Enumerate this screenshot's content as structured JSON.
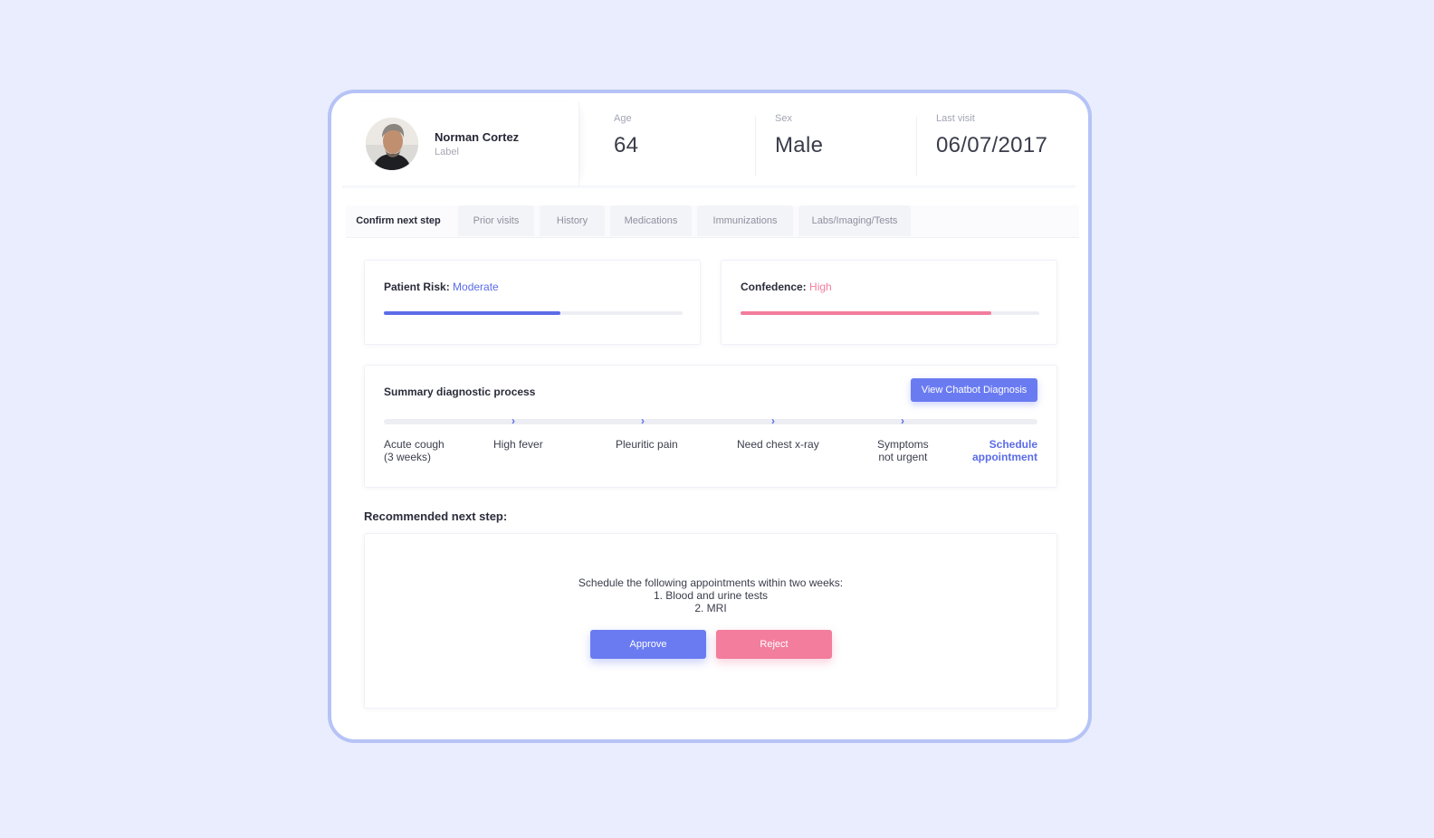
{
  "patient": {
    "name": "Norman Cortez",
    "label": "Label"
  },
  "stats": {
    "age_label": "Age",
    "age_value": "64",
    "sex_label": "Sex",
    "sex_value": "Male",
    "last_visit_label": "Last visit",
    "last_visit_value": "06/07/2017"
  },
  "tabs": [
    {
      "label": "Confirm next step",
      "active": true
    },
    {
      "label": "Prior visits"
    },
    {
      "label": "History"
    },
    {
      "label": "Medications"
    },
    {
      "label": "Immunizations"
    },
    {
      "label": "Labs/Imaging/Tests"
    }
  ],
  "risk": {
    "label": "Patient Risk:",
    "value": "Moderate",
    "level": 0.59,
    "color": "#5b6ce8"
  },
  "confidence": {
    "label": "Confedence:",
    "value": "High",
    "level": 0.84,
    "color": "#f27d9d"
  },
  "summary": {
    "title": "Summary diagnostic process",
    "button_label": "View Chatbot Diagnosis",
    "steps": [
      {
        "line1": "Acute cough",
        "line2": "(3 weeks)"
      },
      {
        "line1": "High fever",
        "line2": ""
      },
      {
        "line1": "Pleuritic pain",
        "line2": ""
      },
      {
        "line1": "Need chest x-ray",
        "line2": ""
      },
      {
        "line1": "Symptoms",
        "line2": "not urgent"
      },
      {
        "line1": "Schedule",
        "line2": "appointment"
      }
    ]
  },
  "recommendation": {
    "heading": "Recommended next step:",
    "line1": "Schedule the following appointments within two weeks:",
    "line2": "1. Blood and urine tests",
    "line3": "2. MRI",
    "approve_label": "Approve",
    "reject_label": "Reject"
  },
  "colors": {
    "accent": "#6a7bf2",
    "pink": "#f27d9d",
    "frame": "#b6c3f6",
    "background": "#e9edfd"
  }
}
